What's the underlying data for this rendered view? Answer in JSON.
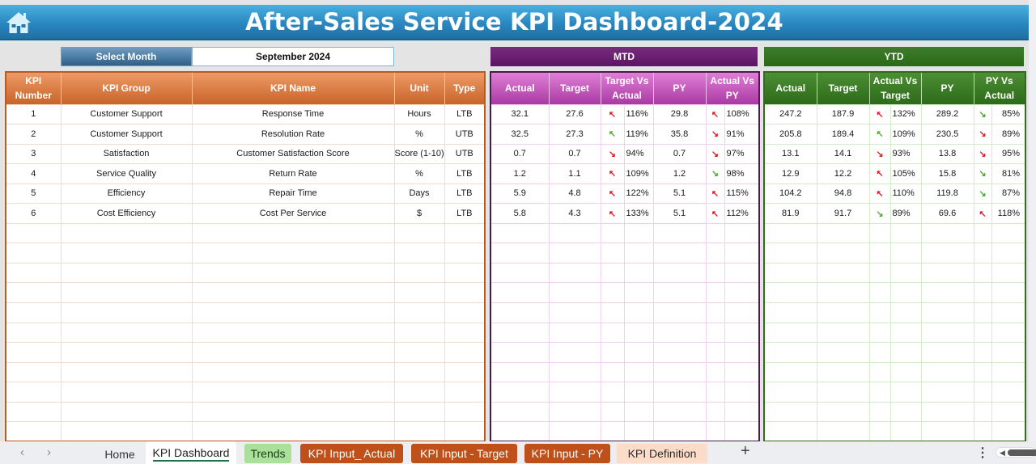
{
  "header": {
    "title": "After-Sales Service KPI Dashboard-2024",
    "home_icon": "home-icon"
  },
  "filter": {
    "label": "Select Month",
    "value": "September 2024"
  },
  "bands": {
    "mtd": "MTD",
    "ytd": "YTD"
  },
  "left_headers": [
    "KPI Number",
    "KPI Group",
    "KPI Name",
    "Unit",
    "Type"
  ],
  "mtd_headers": [
    "Actual",
    "Target",
    "Target Vs Actual",
    "PY",
    "Actual Vs PY"
  ],
  "ytd_headers": [
    "Actual",
    "Target",
    "Actual Vs Target",
    "PY",
    "PY Vs Actual"
  ],
  "colors": {
    "up_bad": "#e81524",
    "good": "#4caa2f",
    "title_bar": "#2a87c0",
    "mtd": "#7b2a82",
    "ytd": "#3c7f26",
    "kpi_header": "#c8642a"
  },
  "rows": [
    {
      "num": "1",
      "group": "Customer Support",
      "name": "Response Time",
      "unit": "Hours",
      "type": "LTB",
      "mtd": {
        "actual": "32.1",
        "target": "27.6",
        "tva_arrow": "↖",
        "tva_color": "red",
        "tva": "116%",
        "py": "29.8",
        "avp_arrow": "↖",
        "avp_color": "red",
        "avp": "108%"
      },
      "ytd": {
        "actual": "247.2",
        "target": "187.9",
        "avt_arrow": "↖",
        "avt_color": "red",
        "avt": "132%",
        "py": "289.2",
        "pva_arrow": "↘",
        "pva_color": "green",
        "pva": "85%"
      }
    },
    {
      "num": "2",
      "group": "Customer Support",
      "name": "Resolution Rate",
      "unit": "%",
      "type": "UTB",
      "mtd": {
        "actual": "32.5",
        "target": "27.3",
        "tva_arrow": "↖",
        "tva_color": "green",
        "tva": "119%",
        "py": "35.8",
        "avp_arrow": "↘",
        "avp_color": "red",
        "avp": "91%"
      },
      "ytd": {
        "actual": "205.8",
        "target": "189.4",
        "avt_arrow": "↖",
        "avt_color": "green",
        "avt": "109%",
        "py": "230.5",
        "pva_arrow": "↘",
        "pva_color": "red",
        "pva": "89%"
      }
    },
    {
      "num": "3",
      "group": "Satisfaction",
      "name": "Customer Satisfaction Score",
      "unit": "Score (1-10)",
      "type": "UTB",
      "mtd": {
        "actual": "0.7",
        "target": "0.7",
        "tva_arrow": "↘",
        "tva_color": "red",
        "tva": "94%",
        "py": "0.7",
        "avp_arrow": "↘",
        "avp_color": "red",
        "avp": "97%"
      },
      "ytd": {
        "actual": "13.1",
        "target": "14.1",
        "avt_arrow": "↘",
        "avt_color": "red",
        "avt": "93%",
        "py": "13.8",
        "pva_arrow": "↘",
        "pva_color": "red",
        "pva": "95%"
      }
    },
    {
      "num": "4",
      "group": "Service Quality",
      "name": "Return Rate",
      "unit": "%",
      "type": "LTB",
      "mtd": {
        "actual": "1.2",
        "target": "1.1",
        "tva_arrow": "↖",
        "tva_color": "red",
        "tva": "109%",
        "py": "1.2",
        "avp_arrow": "↘",
        "avp_color": "green",
        "avp": "98%"
      },
      "ytd": {
        "actual": "12.9",
        "target": "12.2",
        "avt_arrow": "↖",
        "avt_color": "red",
        "avt": "105%",
        "py": "15.8",
        "pva_arrow": "↘",
        "pva_color": "green",
        "pva": "81%"
      }
    },
    {
      "num": "5",
      "group": "Efficiency",
      "name": "Repair Time",
      "unit": "Days",
      "type": "LTB",
      "mtd": {
        "actual": "5.9",
        "target": "4.8",
        "tva_arrow": "↖",
        "tva_color": "red",
        "tva": "122%",
        "py": "5.1",
        "avp_arrow": "↖",
        "avp_color": "red",
        "avp": "115%"
      },
      "ytd": {
        "actual": "104.2",
        "target": "94.8",
        "avt_arrow": "↖",
        "avt_color": "red",
        "avt": "110%",
        "py": "119.8",
        "pva_arrow": "↘",
        "pva_color": "green",
        "pva": "87%"
      }
    },
    {
      "num": "6",
      "group": "Cost Efficiency",
      "name": "Cost Per Service",
      "unit": "$",
      "type": "LTB",
      "mtd": {
        "actual": "5.8",
        "target": "4.3",
        "tva_arrow": "↖",
        "tva_color": "red",
        "tva": "133%",
        "py": "5.1",
        "avp_arrow": "↖",
        "avp_color": "red",
        "avp": "112%"
      },
      "ytd": {
        "actual": "81.9",
        "target": "91.7",
        "avt_arrow": "↘",
        "avt_color": "green",
        "avt": "89%",
        "py": "69.6",
        "pva_arrow": "↖",
        "pva_color": "red",
        "pva": "118%"
      }
    }
  ],
  "empty_rows": 11,
  "sheet_tabs": {
    "nav_prev": "‹",
    "nav_next": "›",
    "items": [
      "Home",
      "KPI Dashboard",
      "Trends",
      "KPI Input_ Actual",
      "KPI Input - Target",
      "KPI Input - PY",
      "KPI Definition"
    ],
    "active": "KPI Dashboard",
    "add": "+",
    "more": "⋮"
  }
}
